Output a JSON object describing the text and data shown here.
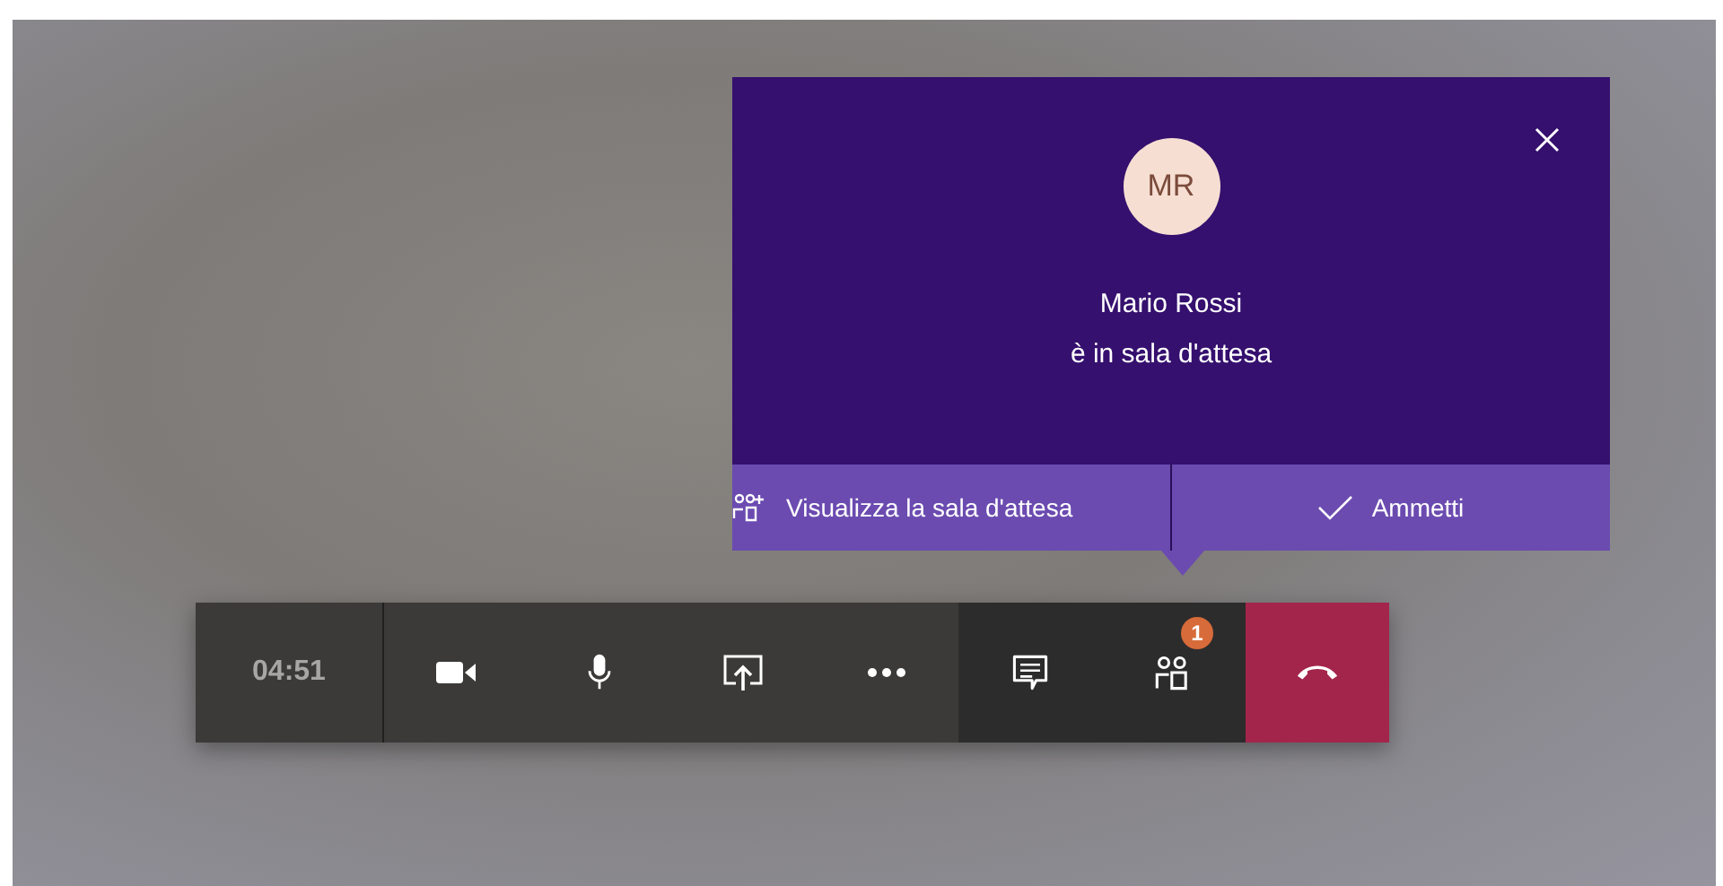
{
  "lobby_notification": {
    "initials": "MR",
    "name": "Mario Rossi",
    "message": "è in sala d'attesa",
    "actions": [
      {
        "kind": "view",
        "label": "Visualizza la sala d'attesa"
      },
      {
        "kind": "admit",
        "label": "Ammetti"
      }
    ]
  },
  "call_controls": {
    "timer": "04:51",
    "buttons": [
      {
        "kind": "camera"
      },
      {
        "kind": "mic"
      },
      {
        "kind": "share"
      },
      {
        "kind": "more"
      },
      {
        "kind": "chat"
      },
      {
        "kind": "people",
        "badge": "1"
      },
      {
        "kind": "hangup"
      }
    ]
  }
}
